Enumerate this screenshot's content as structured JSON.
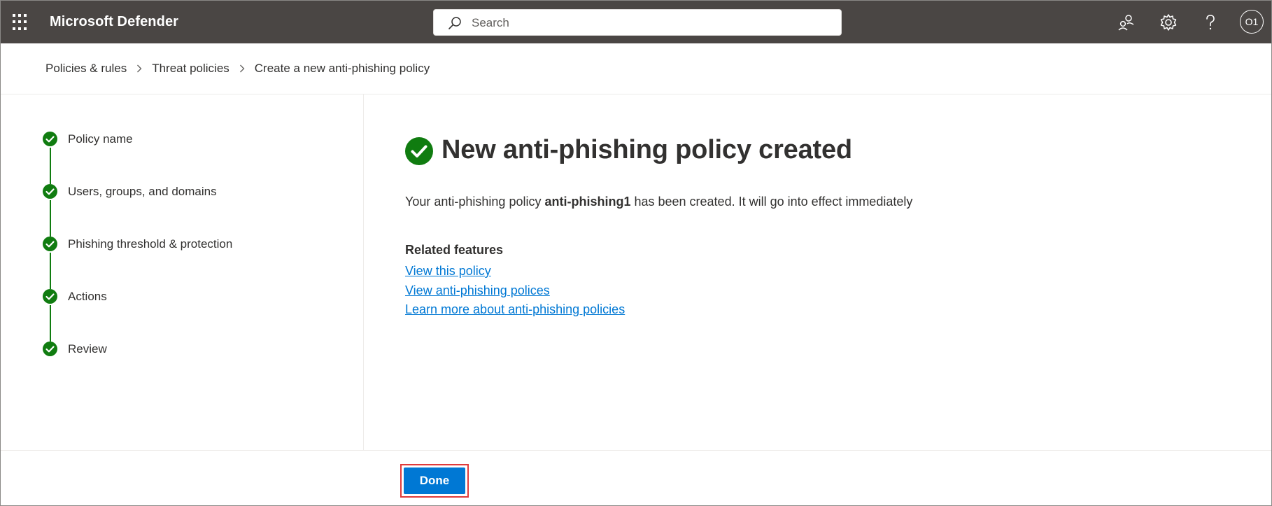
{
  "header": {
    "app_title": "Microsoft Defender",
    "search_placeholder": "Search",
    "avatar_initials": "O1",
    "background_color": "#4a4644",
    "icons": [
      "waffle-icon",
      "search-icon",
      "community-icon",
      "settings-icon",
      "help-icon"
    ]
  },
  "breadcrumb": {
    "items": [
      "Policies & rules",
      "Threat policies",
      "Create a new anti-phishing policy"
    ]
  },
  "steps": {
    "items": [
      {
        "label": "Policy name",
        "status": "completed"
      },
      {
        "label": "Users, groups, and domains",
        "status": "completed"
      },
      {
        "label": "Phishing threshold & protection",
        "status": "completed"
      },
      {
        "label": "Actions",
        "status": "completed"
      },
      {
        "label": "Review",
        "status": "completed"
      }
    ],
    "complete_color": "#107c10"
  },
  "main": {
    "title": "New anti-phishing policy created",
    "description": {
      "prefix": "Your anti-phishing policy ",
      "policy_name": "anti-phishing1",
      "suffix": " has been created. It will go into effect immediately"
    },
    "related_heading": "Related features",
    "links": [
      "View this policy",
      "View anti-phishing polices",
      "Learn more about anti-phishing policies"
    ],
    "link_color": "#0078d4"
  },
  "footer": {
    "done_label": "Done",
    "button_color": "#0078d4",
    "highlight_color": "#e03a3a"
  }
}
